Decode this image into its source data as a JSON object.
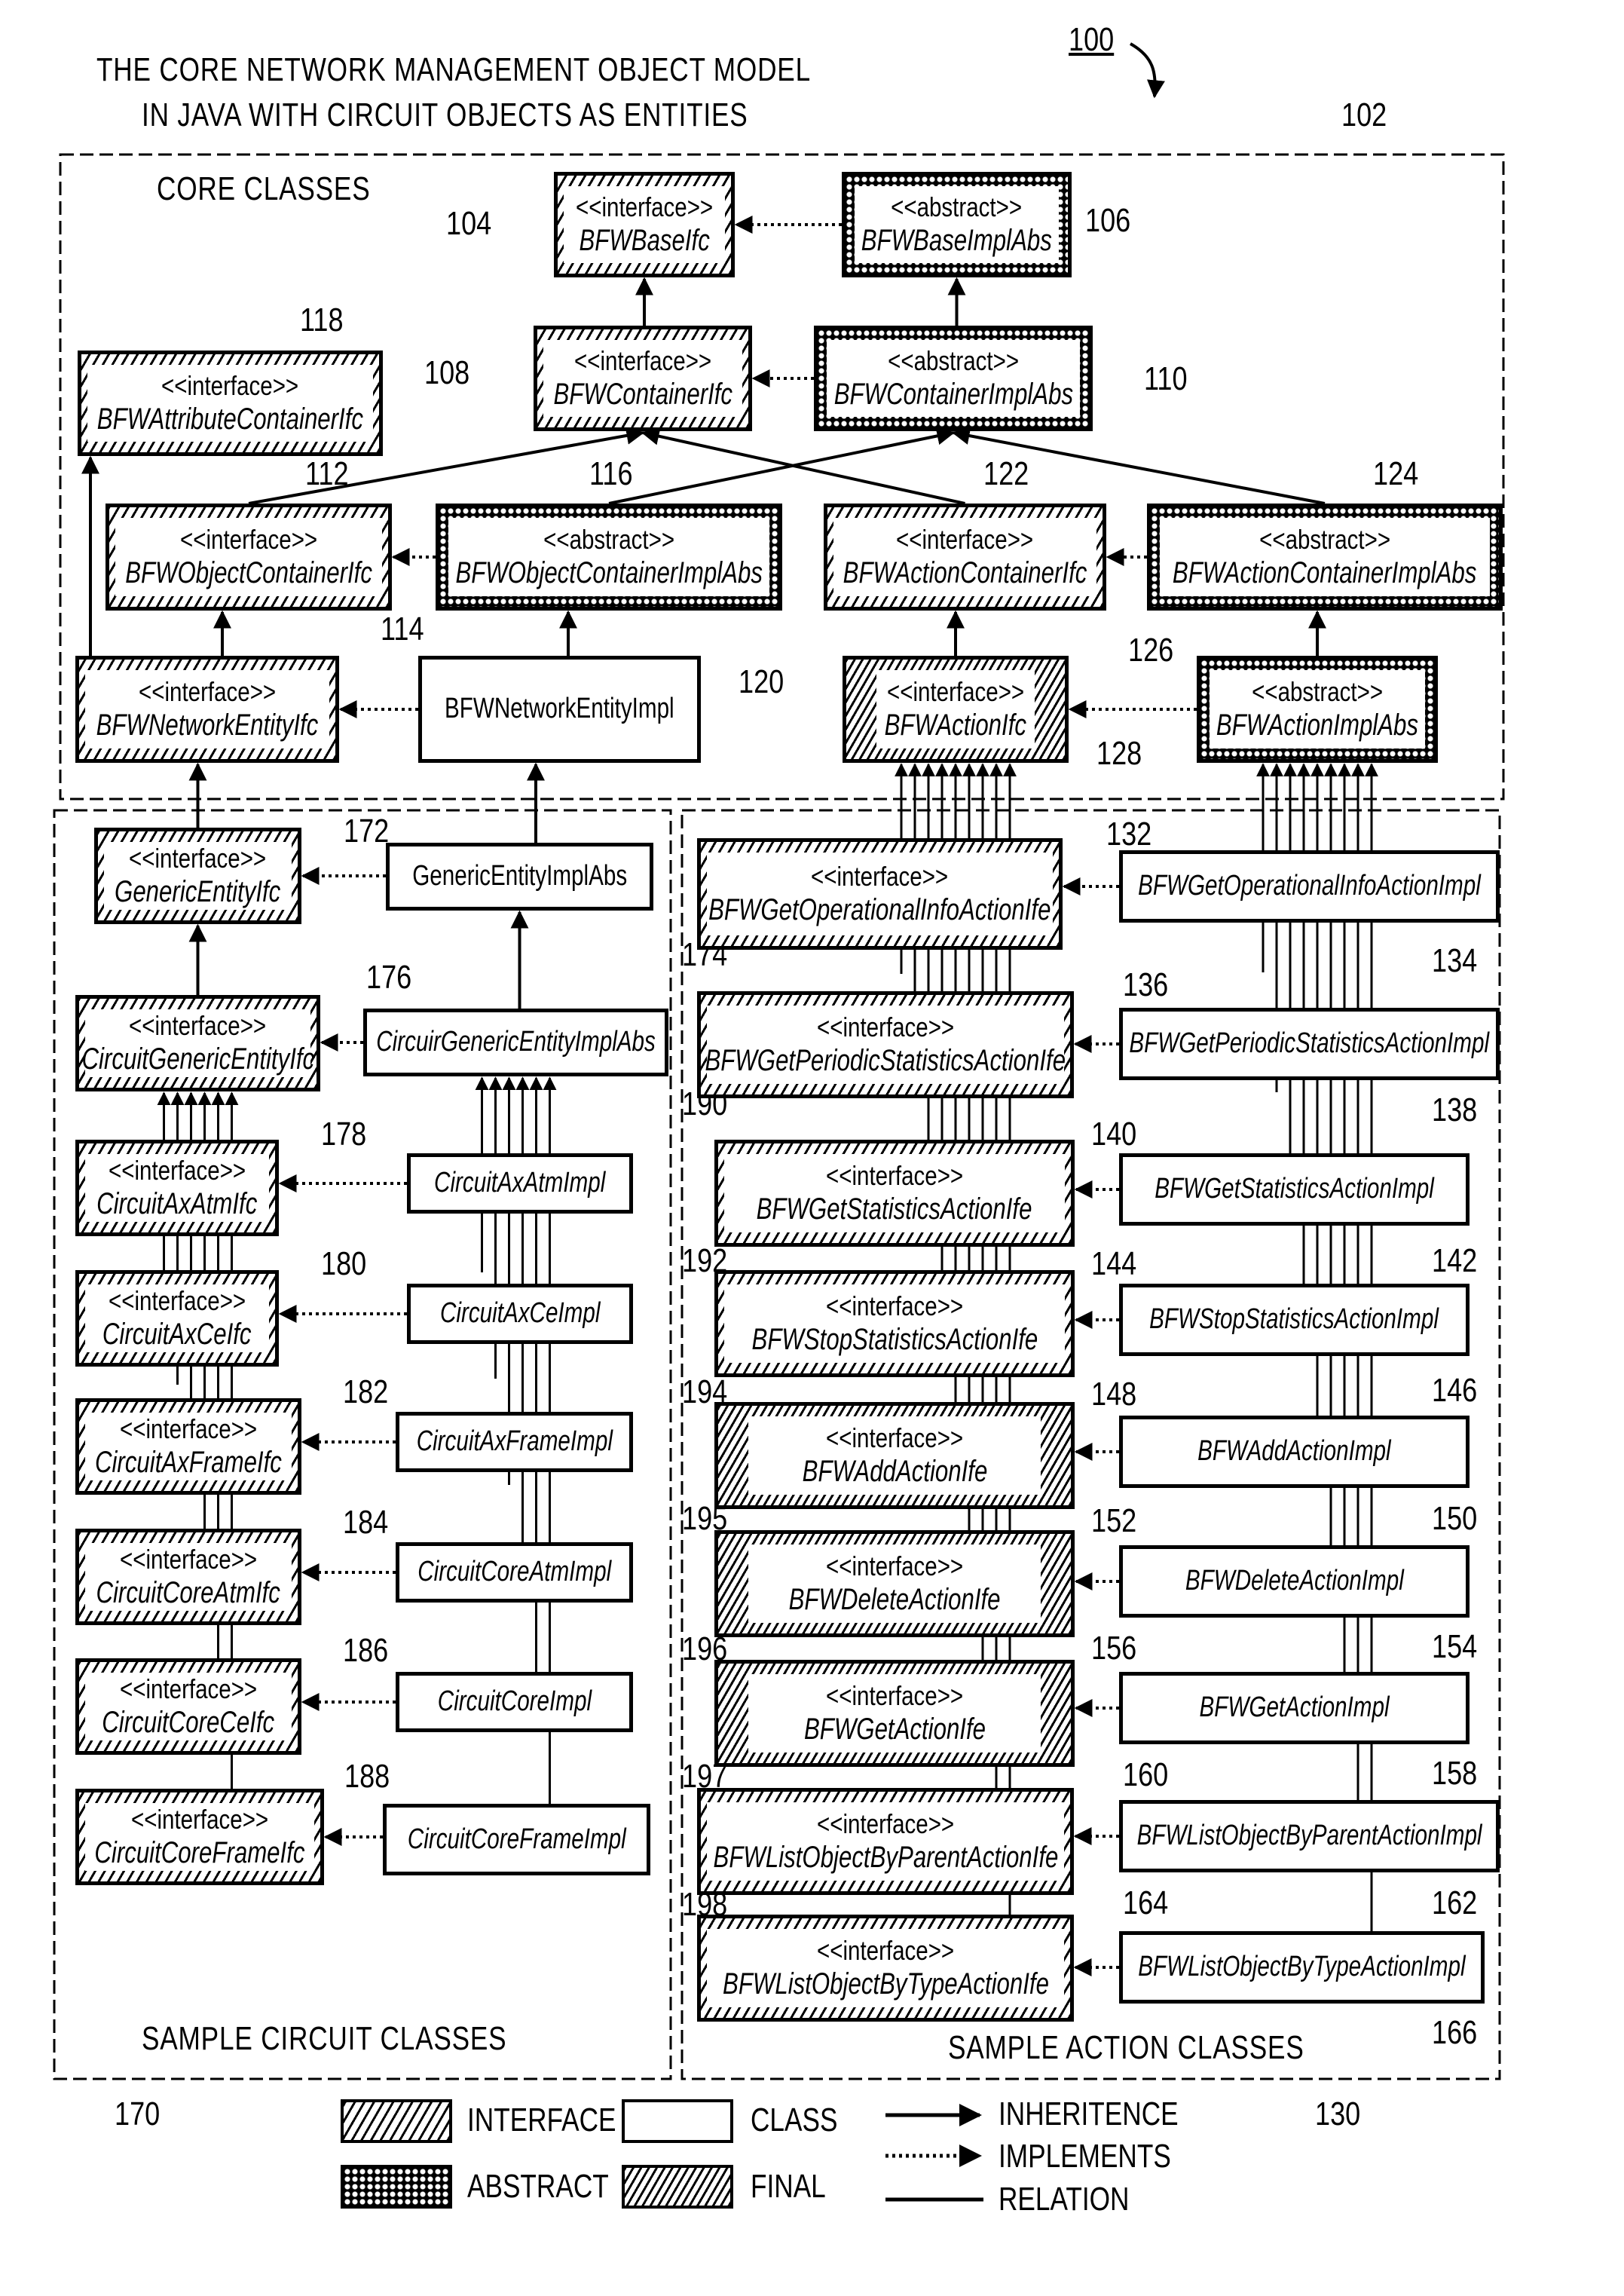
{
  "figure": {
    "number": "100",
    "title_line1": "THE CORE NETWORK MANAGEMENT OBJECT MODEL",
    "title_line2": "IN JAVA WITH CIRCUIT OBJECTS AS ENTITIES"
  },
  "regions": [
    {
      "id": "core",
      "label": "CORE CLASSES",
      "ref": "102"
    },
    {
      "id": "circuit",
      "label": "SAMPLE CIRCUIT CLASSES",
      "ref": "170"
    },
    {
      "id": "action",
      "label": "SAMPLE ACTION CLASSES",
      "ref": "130"
    }
  ],
  "stereotypes": {
    "interface": "<<interface>>",
    "abstract": "<<abstract>>"
  },
  "classes": [
    {
      "ref": "104",
      "name": "BFWBaseIfc",
      "kind": "interface",
      "region": "core"
    },
    {
      "ref": "106",
      "name": "BFWBaseImplAbs",
      "kind": "abstract",
      "region": "core"
    },
    {
      "ref": "108",
      "name": "BFWContainerIfc",
      "kind": "interface",
      "region": "core"
    },
    {
      "ref": "110",
      "name": "BFWContainerImplAbs",
      "kind": "abstract",
      "region": "core"
    },
    {
      "ref": "118",
      "name": "BFWAttributeContainerIfc",
      "kind": "interface",
      "region": "core"
    },
    {
      "ref": "112",
      "name": "BFWObjectContainerIfc",
      "kind": "interface",
      "region": "core"
    },
    {
      "ref": "116",
      "name": "BFWObjectContainerImplAbs",
      "kind": "abstract",
      "region": "core"
    },
    {
      "ref": "122",
      "name": "BFWActionContainerIfc",
      "kind": "interface",
      "region": "core"
    },
    {
      "ref": "124",
      "name": "BFWActionContainerImplAbs",
      "kind": "abstract",
      "region": "core"
    },
    {
      "ref": "114",
      "name": "BFWNetworkEntityIfc",
      "kind": "interface",
      "region": "core"
    },
    {
      "ref": "120",
      "name": "BFWNetworkEntityImpl",
      "kind": "class",
      "region": "core"
    },
    {
      "ref": "126",
      "name": "BFWActionIfc",
      "kind": "final",
      "region": "core"
    },
    {
      "ref": "128",
      "name": "BFWActionImplAbs",
      "kind": "abstract",
      "region": "core"
    },
    {
      "ref": "172",
      "name": "GenericEntityIfc",
      "kind": "interface",
      "region": "circuit"
    },
    {
      "ref": "174",
      "name": "GenericEntityImplAbs",
      "kind": "class",
      "region": "circuit"
    },
    {
      "ref": "176",
      "name": "CircuitGenericEntityIfc",
      "kind": "interface",
      "region": "circuit"
    },
    {
      "ref": "190",
      "name": "CircuirGenericEntityImplAbs",
      "kind": "class",
      "region": "circuit"
    },
    {
      "ref": "178",
      "name": "CircuitAxAtmIfc",
      "kind": "interface",
      "region": "circuit"
    },
    {
      "ref": "192",
      "name": "CircuitAxAtmImpl",
      "kind": "class",
      "region": "circuit"
    },
    {
      "ref": "180",
      "name": "CircuitAxCeIfc",
      "kind": "interface",
      "region": "circuit"
    },
    {
      "ref": "194",
      "name": "CircuitAxCeImpl",
      "kind": "class",
      "region": "circuit"
    },
    {
      "ref": "182",
      "name": "CircuitAxFrameIfc",
      "kind": "interface",
      "region": "circuit"
    },
    {
      "ref": "195",
      "name": "CircuitAxFrameImpl",
      "kind": "class",
      "region": "circuit"
    },
    {
      "ref": "184",
      "name": "CircuitCoreAtmIfc",
      "kind": "interface",
      "region": "circuit"
    },
    {
      "ref": "196",
      "name": "CircuitCoreAtmImpl",
      "kind": "class",
      "region": "circuit"
    },
    {
      "ref": "186",
      "name": "CircuitCoreCeIfc",
      "kind": "interface",
      "region": "circuit"
    },
    {
      "ref": "197",
      "name": "CircuitCoreImpl",
      "kind": "class",
      "region": "circuit"
    },
    {
      "ref": "188",
      "name": "CircuitCoreFrameIfc",
      "kind": "interface",
      "region": "circuit"
    },
    {
      "ref": "198",
      "name": "CircuitCoreFrameImpl",
      "kind": "class",
      "region": "circuit"
    },
    {
      "ref": "132",
      "name": "BFWGetOperationalInfoActionIfe",
      "kind": "interface",
      "region": "action"
    },
    {
      "ref": "134",
      "name": "BFWGetOperationalInfoActionImpl",
      "kind": "class",
      "region": "action"
    },
    {
      "ref": "136",
      "name": "BFWGetPeriodicStatisticsActionIfe",
      "kind": "interface",
      "region": "action"
    },
    {
      "ref": "138",
      "name": "BFWGetPeriodicStatisticsActionImpl",
      "kind": "class",
      "region": "action"
    },
    {
      "ref": "140",
      "name": "BFWGetStatisticsActionIfe",
      "kind": "interface",
      "region": "action"
    },
    {
      "ref": "142",
      "name": "BFWGetStatisticsActionImpl",
      "kind": "class",
      "region": "action"
    },
    {
      "ref": "144",
      "name": "BFWStopStatisticsActionIfe",
      "kind": "interface",
      "region": "action"
    },
    {
      "ref": "146",
      "name": "BFWStopStatisticsActionImpl",
      "kind": "class",
      "region": "action"
    },
    {
      "ref": "148",
      "name": "BFWAddActionIfe",
      "kind": "final",
      "region": "action"
    },
    {
      "ref": "150",
      "name": "BFWAddActionImpl",
      "kind": "class",
      "region": "action"
    },
    {
      "ref": "152",
      "name": "BFWDeleteActionIfe",
      "kind": "final",
      "region": "action"
    },
    {
      "ref": "154",
      "name": "BFWDeleteActionImpl",
      "kind": "class",
      "region": "action"
    },
    {
      "ref": "156",
      "name": "BFWGetActionIfe",
      "kind": "final",
      "region": "action"
    },
    {
      "ref": "158",
      "name": "BFWGetActionImpl",
      "kind": "class",
      "region": "action"
    },
    {
      "ref": "160",
      "name": "BFWListObjectByParentActionIfe",
      "kind": "interface",
      "region": "action"
    },
    {
      "ref": "162",
      "name": "BFWListObjectByParentActionImpl",
      "kind": "class",
      "region": "action"
    },
    {
      "ref": "164",
      "name": "BFWListObjectByTypeActionIfe",
      "kind": "interface",
      "region": "action"
    },
    {
      "ref": "166",
      "name": "BFWListObjectByTypeActionImpl",
      "kind": "class",
      "region": "action"
    }
  ],
  "relations": [
    {
      "type": "implements",
      "from": "106",
      "to": "104"
    },
    {
      "type": "inheritance",
      "from": "108",
      "to": "104"
    },
    {
      "type": "inheritance",
      "from": "110",
      "to": "106"
    },
    {
      "type": "implements",
      "from": "110",
      "to": "108"
    },
    {
      "type": "inheritance",
      "from": "112",
      "to": "108"
    },
    {
      "type": "inheritance",
      "from": "122",
      "to": "108"
    },
    {
      "type": "inheritance",
      "from": "116",
      "to": "110"
    },
    {
      "type": "inheritance",
      "from": "124",
      "to": "110"
    },
    {
      "type": "implements",
      "from": "116",
      "to": "112"
    },
    {
      "type": "implements",
      "from": "124",
      "to": "122"
    },
    {
      "type": "inheritance",
      "from": "114",
      "to": "112"
    },
    {
      "type": "inheritance",
      "from": "114",
      "to": "118"
    },
    {
      "type": "inheritance",
      "from": "120",
      "to": "116"
    },
    {
      "type": "implements",
      "from": "120",
      "to": "114"
    },
    {
      "type": "inheritance",
      "from": "126",
      "to": "122"
    },
    {
      "type": "inheritance",
      "from": "128",
      "to": "124"
    },
    {
      "type": "implements",
      "from": "128",
      "to": "126"
    },
    {
      "type": "inheritance",
      "from": "172",
      "to": "114"
    },
    {
      "type": "inheritance",
      "from": "174",
      "to": "120"
    },
    {
      "type": "implements",
      "from": "174",
      "to": "172"
    },
    {
      "type": "inheritance",
      "from": "176",
      "to": "172"
    },
    {
      "type": "inheritance",
      "from": "190",
      "to": "174"
    },
    {
      "type": "implements",
      "from": "190",
      "to": "176"
    },
    {
      "type": "implements",
      "from": "192",
      "to": "178"
    },
    {
      "type": "implements",
      "from": "194",
      "to": "180"
    },
    {
      "type": "implements",
      "from": "195",
      "to": "182"
    },
    {
      "type": "implements",
      "from": "196",
      "to": "184"
    },
    {
      "type": "implements",
      "from": "197",
      "to": "186"
    },
    {
      "type": "implements",
      "from": "198",
      "to": "188"
    },
    {
      "type": "implements",
      "from": "134",
      "to": "132"
    },
    {
      "type": "implements",
      "from": "138",
      "to": "136"
    },
    {
      "type": "implements",
      "from": "142",
      "to": "140"
    },
    {
      "type": "implements",
      "from": "146",
      "to": "144"
    },
    {
      "type": "implements",
      "from": "150",
      "to": "148"
    },
    {
      "type": "implements",
      "from": "154",
      "to": "152"
    },
    {
      "type": "implements",
      "from": "158",
      "to": "156"
    },
    {
      "type": "implements",
      "from": "162",
      "to": "160"
    },
    {
      "type": "implements",
      "from": "166",
      "to": "164"
    }
  ],
  "bundles": [
    {
      "to": "176",
      "lines": 6,
      "from_column": "circuit-interfaces"
    },
    {
      "to": "190",
      "lines": 6,
      "from_column": "circuit-impls"
    },
    {
      "to": "126",
      "lines": 9,
      "from_column": "action-interfaces"
    },
    {
      "to": "128",
      "lines": 9,
      "from_column": "action-impls"
    }
  ],
  "legend": {
    "interface": "INTERFACE",
    "class": "CLASS",
    "abstract": "ABSTRACT",
    "final": "FINAL",
    "inheritance": "INHERITENCE",
    "implements": "IMPLEMENTS",
    "relation": "RELATION"
  }
}
